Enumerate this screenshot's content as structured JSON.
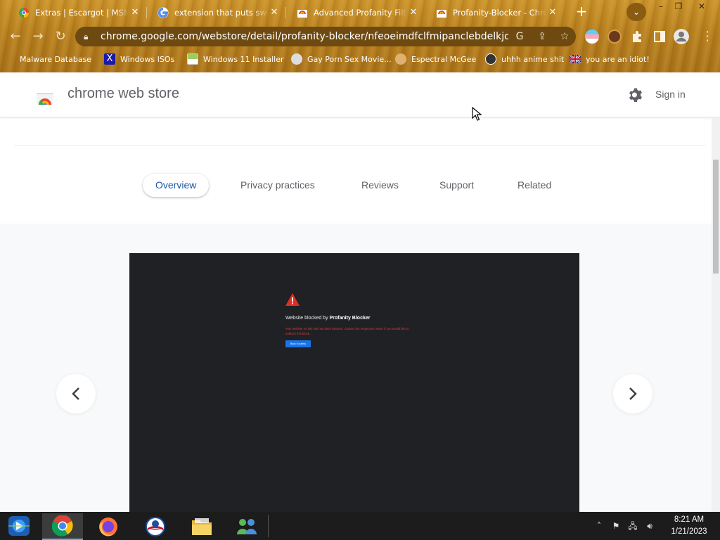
{
  "browser": {
    "tabs": [
      {
        "title": "Extras | Escargot | MSN",
        "favicon": "escargot-icon",
        "active": false
      },
      {
        "title": "extension that puts swear",
        "favicon": "google-icon",
        "active": false
      },
      {
        "title": "Advanced Profanity Filter",
        "favicon": "webstore-icon",
        "active": false
      },
      {
        "title": "Profanity-Blocker - Chrome",
        "favicon": "webstore-icon",
        "active": true
      }
    ],
    "new_tab_label": "+",
    "url": "chrome.google.com/webstore/detail/profanity-blocker/nfeoeimdfclfmipanclebdelkjdh...",
    "bookmarks": [
      {
        "label": "Malware Database",
        "icon": "folder-icon"
      },
      {
        "label": "Windows ISOs",
        "icon": "x-logo-icon"
      },
      {
        "label": "Windows 11 Installer",
        "icon": "image-icon"
      },
      {
        "label": "Gay Porn Sex Movie...",
        "icon": "face-icon"
      },
      {
        "label": "Espectral McGee",
        "icon": "avatar-icon"
      },
      {
        "label": "uhhh anime shit",
        "icon": "avatar-icon"
      },
      {
        "label": "you are an idiot!",
        "icon": "uk-flag-icon"
      }
    ]
  },
  "store": {
    "name": "chrome web store",
    "signin": "Sign in",
    "tabs": [
      {
        "label": "Overview",
        "selected": true
      },
      {
        "label": "Privacy practices",
        "selected": false
      },
      {
        "label": "Reviews",
        "selected": false
      },
      {
        "label": "Support",
        "selected": false
      },
      {
        "label": "Related",
        "selected": false
      }
    ],
    "screenshot": {
      "blocked_prefix": "Website blocked by ",
      "blocked_name": "Profanity Blocker",
      "detail": "Your website on this site has been blocked. Contact the respective owner if you would like to unblock this block.",
      "button": "Back to safety"
    }
  },
  "taskbar": {
    "apps": [
      "windows-media-icon",
      "chrome-icon",
      "firefox-icon",
      "obama-icon",
      "file-explorer-icon",
      "network-people-icon"
    ],
    "time": "8:21 AM",
    "date": "1/21/2023"
  }
}
